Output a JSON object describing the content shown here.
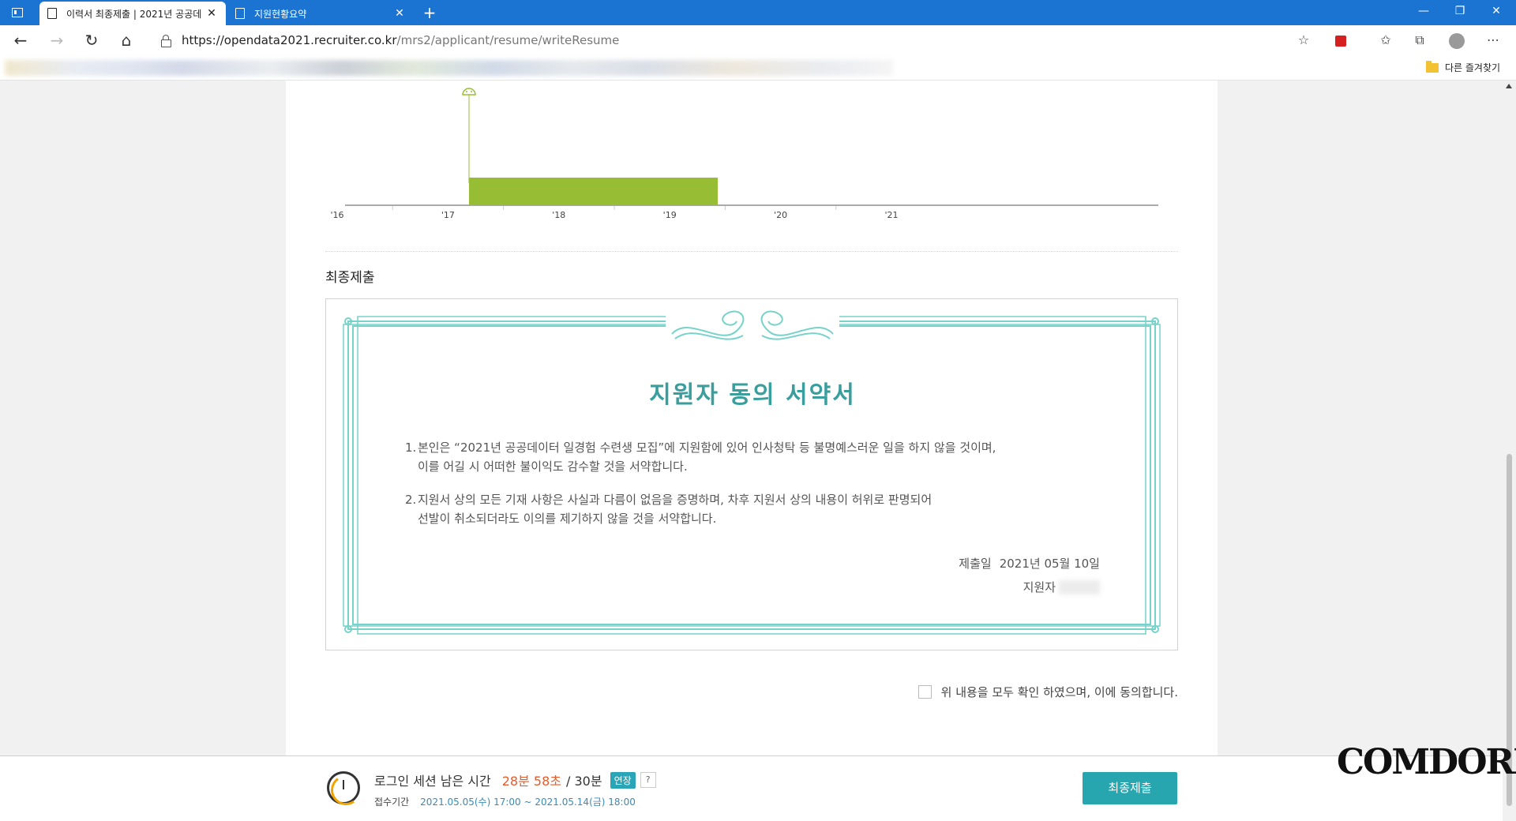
{
  "browser": {
    "tabs": [
      {
        "title": "이력서 최종제출 | 2021년 공공데",
        "active": true
      },
      {
        "title": "지원현황요약",
        "active": false
      }
    ],
    "url_host": "https://opendata2021.recruiter.co.kr",
    "url_path": "/mrs2/applicant/resume/writeResume",
    "other_favorites": "다른 즐겨찾기"
  },
  "timeline": {
    "years": [
      "'16",
      "'17",
      "'18",
      "'19",
      "'20",
      "'21"
    ],
    "bar_color": "#97bd35"
  },
  "section": {
    "title": "최종제출"
  },
  "pledge": {
    "title": "지원자 동의 서약서",
    "items": [
      {
        "num": "1.",
        "line1": "본인은 “2021년 공공데이터 일경험 수련생 모집”에 지원함에 있어 인사청탁 등 불명예스러운 일을 하지 않을 것이며,",
        "line2": "이를 어길 시 어떠한 불이익도 감수할 것을 서약합니다."
      },
      {
        "num": "2.",
        "line1": "지원서 상의 모든 기재 사항은 사실과 다름이 없음을 증명하며, 차후 지원서 상의 내용이 허위로 판명되어",
        "line2": "선발이 취소되더라도 이의를 제기하지 않을 것을 서약합니다."
      }
    ],
    "date_label": "제출일",
    "date_value": "2021년 05월 10일",
    "signer_label": "지원자",
    "accent_color": "#3a9e9d"
  },
  "agree": {
    "label": "위 내용을 모두 확인 하였으며, 이에 동의합니다."
  },
  "session": {
    "label": "로그인 세션 남은 시간",
    "remaining": "28분 58초",
    "total": "/ 30분",
    "extend": "연장",
    "help": "?",
    "period_label": "접수기간",
    "period_value": "2021.05.05(수) 17:00 ~ 2021.05.14(금) 18:00"
  },
  "submit_label": "최종제출",
  "watermark": "COMDORI"
}
